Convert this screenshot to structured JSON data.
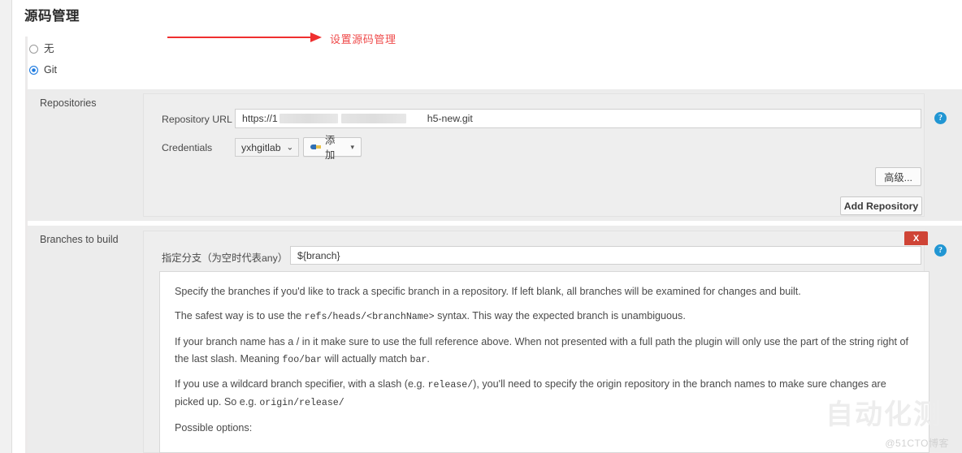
{
  "page": {
    "title": "源码管理"
  },
  "annotation": {
    "text": "设置源码管理",
    "color": "#ef4a4a",
    "arrow_icon": "right-arrow-icon"
  },
  "scm_radios": [
    {
      "label": "无",
      "selected": false,
      "name": "radio-scm-none"
    },
    {
      "label": "Git",
      "selected": true,
      "name": "radio-scm-git"
    }
  ],
  "repositories": {
    "section_label": "Repositories",
    "repository_url": {
      "label": "Repository URL",
      "value_prefix": "https://1",
      "value_suffix": "h5-new.git",
      "redacted": true
    },
    "credentials": {
      "label": "Credentials",
      "selected": "yxhgitlab",
      "add_button": "添加",
      "add_button_icon": "credential-plug-icon",
      "caret_icon": "caret-down-icon"
    },
    "advanced_button": "高级...",
    "add_repository_button": "Add Repository",
    "help_icon": "help-icon"
  },
  "branches": {
    "section_label": "Branches to build",
    "branch_field": {
      "label": "指定分支（为空时代表any）",
      "value": "${branch}"
    },
    "delete_label": "X",
    "help_icon": "help-icon",
    "description": {
      "p1_a": "Specify the branches if you'd like to track a specific branch in a repository. If left blank, all branches will be examined for changes and built.",
      "p2_a": "The safest way is to use the ",
      "p2_code": "refs/heads/<branchName>",
      "p2_b": " syntax. This way the expected branch is unambiguous.",
      "p3_a": "If your branch name has a / in it make sure to use the full reference above. When not presented with a full path the plugin will only use the part of the string right of the last slash. Meaning ",
      "p3_code1": "foo/bar",
      "p3_b": " will actually match ",
      "p3_code2": "bar",
      "p3_c": ".",
      "p4_a": "If you use a wildcard branch specifier, with a slash (e.g. ",
      "p4_code1": "release/",
      "p4_b": "), you'll need to specify the origin repository in the branch names to make sure changes are picked up. So e.g. ",
      "p4_code2": "origin/release/",
      "p5_a": "Possible options:"
    }
  },
  "watermark": {
    "logo_text": "自动化测",
    "handle": "@51CTO博客"
  },
  "colors": {
    "accent_blue": "#1e7be0",
    "help_blue": "#2196d3",
    "danger_red": "#cf4436",
    "annotation_red": "#ef2f2f",
    "panel_grey": "#ececec"
  }
}
